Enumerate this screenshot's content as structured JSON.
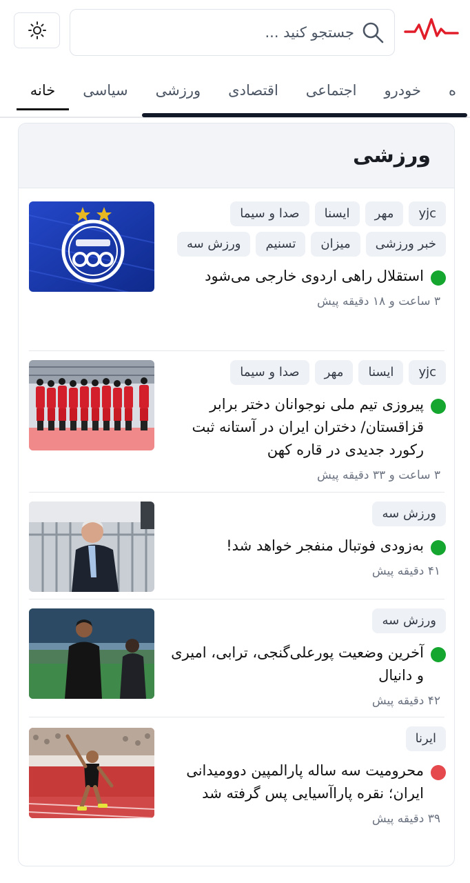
{
  "search": {
    "placeholder": "جستجو کنید ..."
  },
  "tabs": [
    {
      "label": "خانه",
      "active": true
    },
    {
      "label": "سیاسی"
    },
    {
      "label": "ورزشی"
    },
    {
      "label": "اقتصادی"
    },
    {
      "label": "اجتماعی"
    },
    {
      "label": "خودرو"
    },
    {
      "label": "ه"
    }
  ],
  "section": {
    "title": "ورزشی"
  },
  "news": [
    {
      "sources": [
        "yjc",
        "مهر",
        "ایسنا",
        "صدا و سیما",
        "خبر ورزشی",
        "میزان",
        "تسنیم",
        "ورزش سه"
      ],
      "title": "استقلال راهی اردوی خارجی می‌شود",
      "time": "۳ ساعت و ۱۸ دقیقه پیش",
      "status": "green"
    },
    {
      "sources": [
        "yjc",
        "ایسنا",
        "مهر",
        "صدا و سیما"
      ],
      "title": "پیروزی تیم ملی نوجوانان دختر برابر قزاقستان/ دختران ایران در آستانه ثبت رکورد جدیدی در قاره کهن",
      "time": "۳ ساعت و ۳۳ دقیقه پیش",
      "status": "green"
    },
    {
      "sources": [
        "ورزش سه"
      ],
      "title": "به‌زودی فوتبال منفجر خواهد شد!",
      "time": "۴۱ دقیقه پیش",
      "status": "green"
    },
    {
      "sources": [
        "ورزش سه"
      ],
      "title": "آخرین وضعیت پورعلی‌گنجی، ترابی، امیری و دانیال",
      "time": "۴۲ دقیقه پیش",
      "status": "green"
    },
    {
      "sources": [
        "ایرنا"
      ],
      "title": "محرومیت سه ساله پارالمپین دوومیدانی ایران؛ نقره پاراآسیایی پس گرفته شد",
      "time": "۳۹ دقیقه پیش",
      "status": "red"
    }
  ],
  "colors": {
    "accent": "#e11d2a",
    "active_dot": "#15a62f",
    "alert_dot": "#e5484d"
  },
  "icons": {
    "theme": "sun-icon",
    "search": "search-icon",
    "logo": "pulse-logo-icon"
  }
}
